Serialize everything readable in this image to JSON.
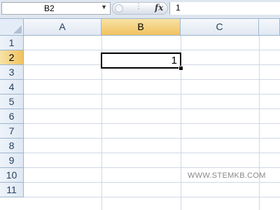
{
  "formula_bar": {
    "name_box": "B2",
    "fx_label": "fx",
    "formula_value": "1"
  },
  "columns": [
    "A",
    "B",
    "C"
  ],
  "rows": [
    "1",
    "2",
    "3",
    "4",
    "5",
    "6",
    "7",
    "8",
    "9",
    "10",
    "11"
  ],
  "selection": {
    "cell": "B2",
    "value": "1",
    "selected_column": "B",
    "selected_row": "2"
  },
  "watermark": "WWW.STEMKB.COM",
  "colors": {
    "header_selected": "#f1c15f",
    "header_bg": "#e4ecf7",
    "gridline": "#d0d7e5",
    "accent_border": "#9eb6ce"
  }
}
